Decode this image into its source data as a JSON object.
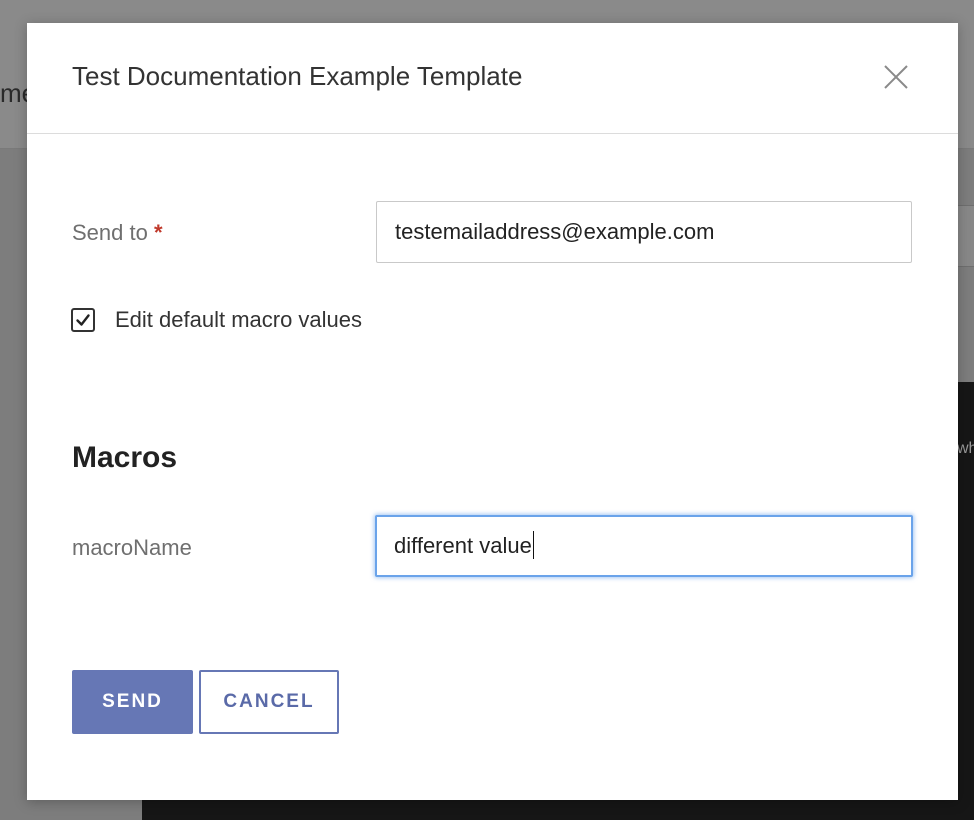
{
  "background": {
    "left_text": "me",
    "right_text": "wh"
  },
  "modal": {
    "title": "Test Documentation Example Template",
    "close_icon": "close-icon"
  },
  "form": {
    "send_to_label": "Send to",
    "required_marker": "*",
    "send_to_value": "testemailaddress@example.com",
    "edit_defaults_label": "Edit default macro values",
    "edit_defaults_checked": true
  },
  "macros": {
    "heading": "Macros",
    "items": [
      {
        "name": "macroName",
        "value": "different value"
      }
    ]
  },
  "buttons": {
    "send_label": "SEND",
    "cancel_label": "CANCEL"
  },
  "colors": {
    "primary": "#6677b5",
    "required": "#c0392b",
    "focus": "#6aa3ea"
  }
}
